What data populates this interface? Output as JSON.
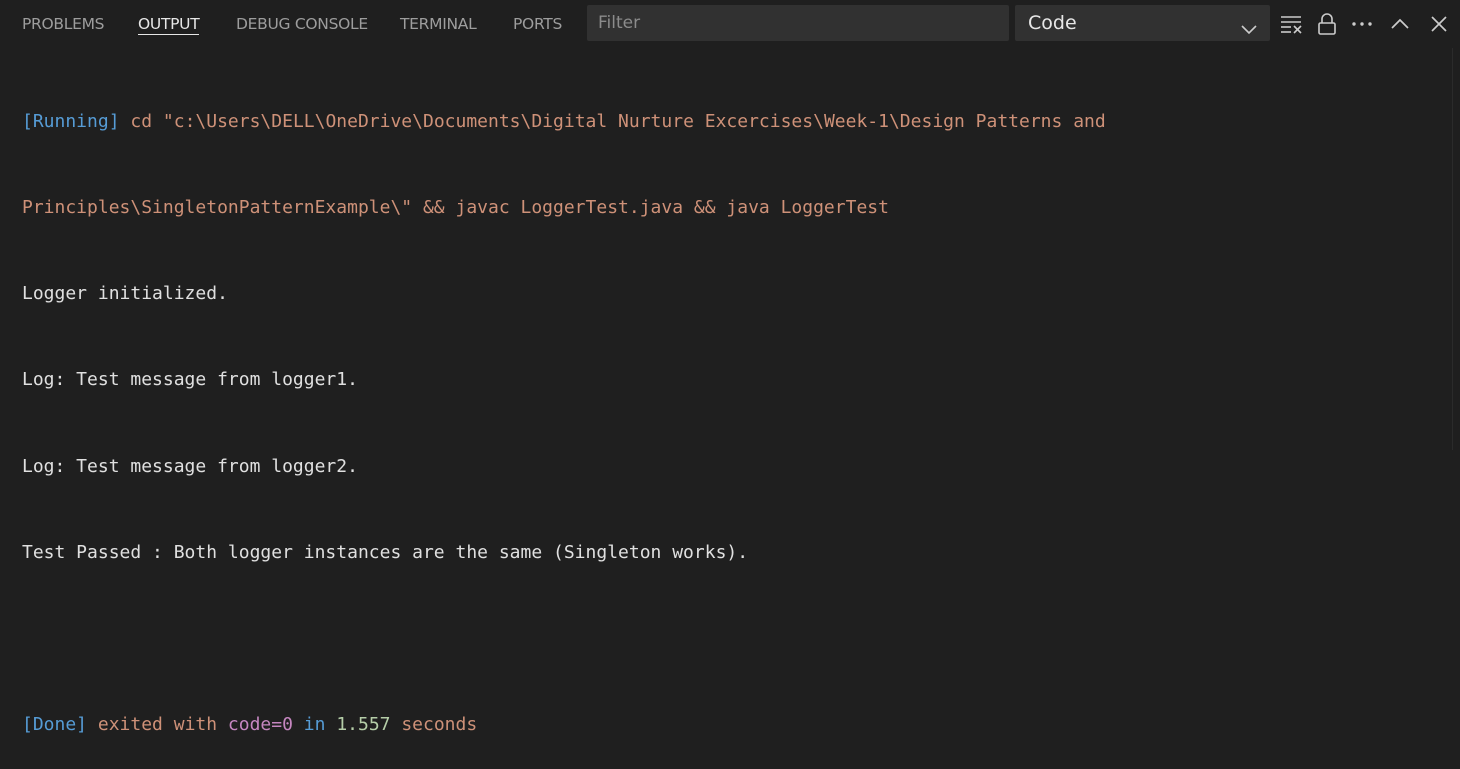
{
  "tabs": [
    {
      "label": "PROBLEMS",
      "active": false
    },
    {
      "label": "OUTPUT",
      "active": true
    },
    {
      "label": "DEBUG CONSOLE",
      "active": false
    },
    {
      "label": "TERMINAL",
      "active": false
    },
    {
      "label": "PORTS",
      "active": false
    }
  ],
  "filter": {
    "placeholder": "Filter",
    "value": ""
  },
  "channel_select": {
    "selected": "Code"
  },
  "toolbar_icons": [
    "clear-output-icon",
    "lock-scroll-icon",
    "more-actions-icon",
    "maximize-panel-icon",
    "close-panel-icon"
  ],
  "output": {
    "running_tag": "[Running]",
    "command_line1": " cd \"c:\\Users\\DELL\\OneDrive\\Documents\\Digital Nurture Excercises\\Week-1\\Design Patterns and",
    "command_line2": "Principles\\SingletonPatternExample\\\" && javac LoggerTest.java && java LoggerTest",
    "lines": [
      "Logger initialized.",
      "Log: Test message from logger1.",
      "Log: Test message from logger2.",
      "Test Passed : Both logger instances are the same (Singleton works)."
    ],
    "done_tag": "[Done]",
    "done_text1": " exited with ",
    "done_code": "code=0",
    "done_text2": " in ",
    "done_time": "1.557",
    "done_text3": " seconds"
  },
  "colors": {
    "background": "#1f1f1f",
    "tag_blue": "#569cd6",
    "string_orange": "#ce9178",
    "keyword_purple": "#c586c0",
    "number_green": "#b5cea8"
  }
}
